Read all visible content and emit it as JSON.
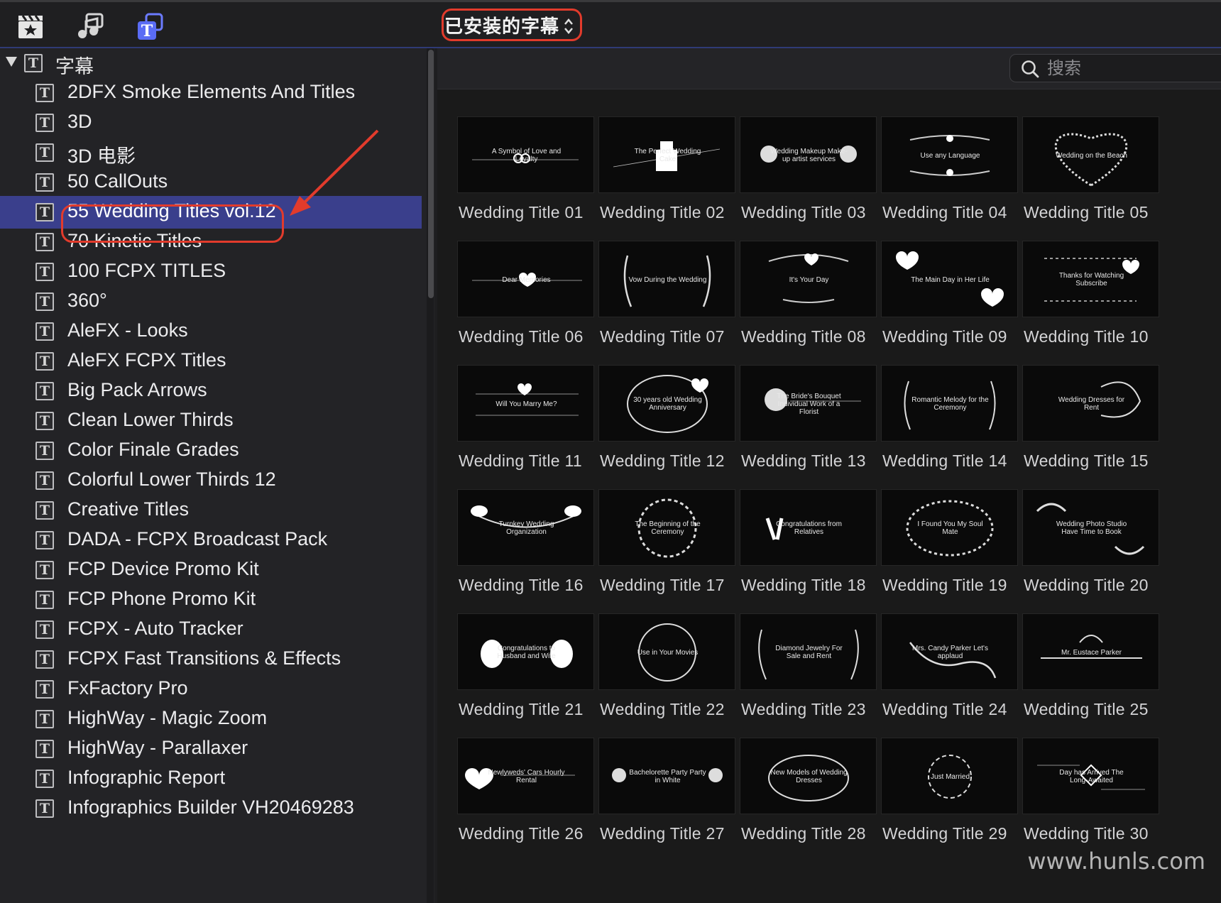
{
  "toolbar": {
    "icons": [
      "clapperboard-star-icon",
      "music-photo-icon",
      "titles-generators-icon"
    ],
    "selector_label": "已安装的字幕"
  },
  "sidebar": {
    "header_label": "字幕",
    "items": [
      {
        "label": "2DFX Smoke Elements And Titles"
      },
      {
        "label": "3D"
      },
      {
        "label": "3D 电影"
      },
      {
        "label": "50 CallOuts"
      },
      {
        "label": "55 Wedding Titles vol.12",
        "selected": true
      },
      {
        "label": "70 Kinetic Titles"
      },
      {
        "label": "100 FCPX TITLES"
      },
      {
        "label": "360°"
      },
      {
        "label": "AleFX - Looks"
      },
      {
        "label": "AleFX FCPX Titles"
      },
      {
        "label": "Big Pack Arrows"
      },
      {
        "label": "Clean Lower Thirds"
      },
      {
        "label": "Color Finale Grades"
      },
      {
        "label": "Colorful Lower Thirds 12"
      },
      {
        "label": "Creative Titles"
      },
      {
        "label": "DADA - FCPX Broadcast Pack"
      },
      {
        "label": "FCP Device Promo Kit"
      },
      {
        "label": "FCP Phone Promo Kit"
      },
      {
        "label": "FCPX - Auto Tracker"
      },
      {
        "label": "FCPX Fast Transitions & Effects"
      },
      {
        "label": "FxFactory Pro"
      },
      {
        "label": "HighWay - Magic Zoom"
      },
      {
        "label": "HighWay - Parallaxer"
      },
      {
        "label": "Infographic Report"
      },
      {
        "label": "Infographics Builder VH20469283"
      }
    ],
    "accent_selected": "#3a3f8c",
    "highlight_ring": "#e23b2c"
  },
  "search": {
    "placeholder": "搜索"
  },
  "tiles": [
    {
      "label": "Wedding Title 01",
      "thumb": "A Symbol of   Love and Loyalty"
    },
    {
      "label": "Wedding Title 02",
      "thumb": "The Perfect   Wedding Cake"
    },
    {
      "label": "Wedding Title 03",
      "thumb": "Wedding Makeup Make-up artist services"
    },
    {
      "label": "Wedding Title 04",
      "thumb": "Use any Language"
    },
    {
      "label": "Wedding Title 05",
      "thumb": "Wedding on the Beach"
    },
    {
      "label": "Wedding Title 06",
      "thumb": "Dear   Memories"
    },
    {
      "label": "Wedding Title 07",
      "thumb": "Vow During the Wedding"
    },
    {
      "label": "Wedding Title 08",
      "thumb": "It's Your Day"
    },
    {
      "label": "Wedding Title 09",
      "thumb": "The Main Day in Her Life"
    },
    {
      "label": "Wedding Title 10",
      "thumb": "Thanks for Watching Subscribe"
    },
    {
      "label": "Wedding Title 11",
      "thumb": "Will You Marry Me?"
    },
    {
      "label": "Wedding Title 12",
      "thumb": "30 years old Wedding Anniversary"
    },
    {
      "label": "Wedding Title 13",
      "thumb": "The Bride's Bouquet Individual Work of a Florist"
    },
    {
      "label": "Wedding Title 14",
      "thumb": "Romantic Melody for the Ceremony"
    },
    {
      "label": "Wedding Title 15",
      "thumb": "Wedding Dresses for Rent"
    },
    {
      "label": "Wedding Title 16",
      "thumb": "Turnkey Wedding Organization"
    },
    {
      "label": "Wedding Title 17",
      "thumb": "The Beginning of the Ceremony"
    },
    {
      "label": "Wedding Title 18",
      "thumb": "Congratulations from Relatives"
    },
    {
      "label": "Wedding Title 19",
      "thumb": "I Found You My Soul Mate"
    },
    {
      "label": "Wedding Title 20",
      "thumb": "Wedding Photo Studio Have Time to Book"
    },
    {
      "label": "Wedding Title 21",
      "thumb": "Congratulations to Husband and Wife"
    },
    {
      "label": "Wedding Title 22",
      "thumb": "Use in Your Movies"
    },
    {
      "label": "Wedding Title 23",
      "thumb": "Diamond Jewelry For Sale and Rent"
    },
    {
      "label": "Wedding Title 24",
      "thumb": "Mrs. Candy Parker Let's applaud"
    },
    {
      "label": "Wedding Title 25",
      "thumb": "Mr. Eustace Parker"
    },
    {
      "label": "Wedding Title 26",
      "thumb": "Newlyweds' Cars Hourly Rental"
    },
    {
      "label": "Wedding Title 27",
      "thumb": "Bachelorette Party Party in White"
    },
    {
      "label": "Wedding Title 28",
      "thumb": "New Models of Wedding Dresses"
    },
    {
      "label": "Wedding Title 29",
      "thumb": "Just Married"
    },
    {
      "label": "Wedding Title 30",
      "thumb": "Day has Arrived   The Long-Awaited"
    }
  ],
  "watermark": "www.hunls.com"
}
